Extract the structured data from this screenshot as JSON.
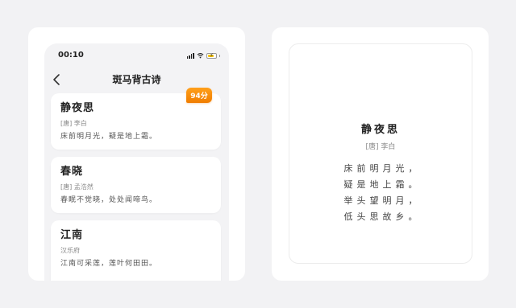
{
  "status_bar": {
    "time": "00:10"
  },
  "nav": {
    "title": "斑马背古诗"
  },
  "poems": [
    {
      "title": "静夜思",
      "author": "[唐] 李白",
      "excerpt": "床前明月光，疑是地上霜。",
      "score": "94分"
    },
    {
      "title": "春晓",
      "author": "[唐] 孟浩然",
      "excerpt": "春眠不觉晓，处处闻啼鸟。"
    },
    {
      "title": "江南",
      "author": "汉乐府",
      "excerpt": "江南可采莲，莲叶何田田。"
    }
  ],
  "preview": {
    "title": "静夜思",
    "author": "[唐] 李白",
    "lines": [
      "床前明月光，",
      "疑是地上霜。",
      "举头望明月，",
      "低头思故乡。"
    ]
  },
  "colors": {
    "badge": "#f59000",
    "background": "#f2f2f4"
  }
}
